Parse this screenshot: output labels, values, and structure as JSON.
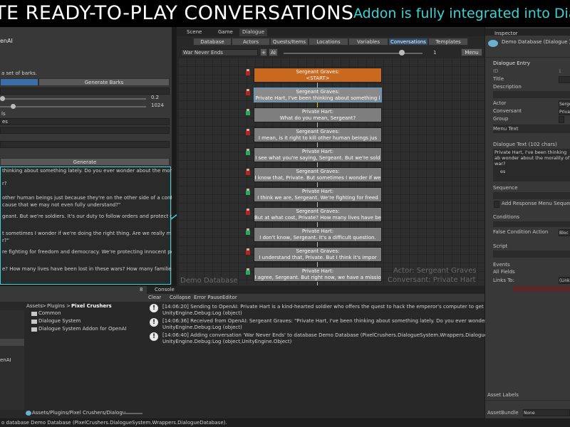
{
  "banner": {
    "title": "TE READY-TO-PLAY CONVERSATIONS",
    "subtitle": "Addon is fully integrated into Dia"
  },
  "left_panel": {
    "title": "enAI",
    "description": "a set of barks.",
    "generate_barks_label": "Generate Barks",
    "slider1_value": "0.2",
    "slider2_value": "1024",
    "label_ls": "ls",
    "label_es": "es",
    "generate_label": "Generate",
    "output_lines": [
      "thinking about something lately. Do you ever wonder about the morality of",
      "r?",
      "other human beings just because they're on the other side of a conflict? Is it",
      "cause that we may not even fully understand?\"",
      "geant. But we're soldiers. It's our duty to follow orders and protect our",
      "t sometimes I wonder if we're doing the right thing. Are we really making the",
      "r?\"",
      "re fighting for freedom and democracy. We're protecting innocent people",
      "e? How many lives have been lost in these wars? How many families have"
    ]
  },
  "editor_tabs": {
    "scene": "Scene",
    "game": "Game",
    "dialogue": "Dialogue"
  },
  "dialogue_tabs": [
    "Database",
    "Actors",
    "Quests/Items",
    "Locations",
    "Variables",
    "Conversations",
    "Templates"
  ],
  "active_dialogue_tab": "Conversations",
  "conversation_toolbar": {
    "conversation": "War Never Ends",
    "plus": "+",
    "ai": "AI",
    "zoom": "1",
    "menu": "Menu"
  },
  "nodes": [
    {
      "speaker": "Sergeant Graves:",
      "text": "<START>"
    },
    {
      "speaker": "Sergeant Graves:",
      "text": "Private Hart, I've been thinking about something l"
    },
    {
      "speaker": "Private Hart:",
      "text": "What do you mean, Sergeant?"
    },
    {
      "speaker": "Sergeant Graves:",
      "text": "I mean, is it right to kill other human beings jus"
    },
    {
      "speaker": "Private Hart:",
      "text": "I see what you're saying, Sergeant. But we're sold"
    },
    {
      "speaker": "Sergeant Graves:",
      "text": "I know that, Private. But sometimes I wonder if we"
    },
    {
      "speaker": "Private Hart:",
      "text": "I think we are, Sergeant. We're fighting for freed"
    },
    {
      "speaker": "Sergeant Graves:",
      "text": "But at what cost, Private? How many lives have bee"
    },
    {
      "speaker": "Private Hart:",
      "text": "I don't know, Sergeant. It's a difficult question."
    },
    {
      "speaker": "Sergeant Graves:",
      "text": "I understand that, Private. But I think it's impor"
    },
    {
      "speaker": "Private Hart:",
      "text": "I agree, Sergeant. But right now, we have a missio"
    }
  ],
  "canvas_watermark": {
    "database": "Demo Database",
    "actor": "Actor: Sergeant Graves",
    "conversant": "Conversant: Private Hart"
  },
  "project": {
    "breadcrumb_assets": "Assets",
    "breadcrumb_plugins": "Plugins",
    "breadcrumb_pixel": "Pixel Crushers",
    "folders": [
      "Common",
      "Dialogue System",
      "Dialogue System Addon for OpenAI"
    ],
    "left_item": "enAI",
    "path": "Assets/Plugins/Pixel Crushers/Dialogu",
    "badge_count": "8"
  },
  "console": {
    "title": "Console",
    "clear": "Clear",
    "collapse": "Collapse",
    "error_pause": "Error Pause",
    "editor": "Editor",
    "entries": [
      {
        "line1": "[14:06:20] Sending to OpenAI: Private Hart is a kind-hearted soldier who offers the quest to hack the emperor's computer to get the launch codes. S",
        "line2": "UnityEngine.Debug:Log (object)"
      },
      {
        "line1": "[14:06:36] Received from OpenAI: Sergeant Graves: \"Private Hart, I've been thinking about something lately. Do you ever wonder about the moralit",
        "line2": "UnityEngine.Debug:Log (object)"
      },
      {
        "line1": "[14:06:40] Adding conversation 'War Never Ends' to database Demo Database (PixelCrushers.DialogueSystem.Wrappers.DialogueDatabase).",
        "line2": "UnityEngine.Debug:Log (object,UnityEngine.Object)"
      }
    ]
  },
  "inspector": {
    "title": "Inspector",
    "object": "Demo Database (Dialogue )",
    "section": "Dialogue Entry",
    "id_label": "ID",
    "id_value": "1",
    "title_label": "Title",
    "description_label": "Description",
    "actor_label": "Actor",
    "actor_value": "Serge",
    "conversant_label": "Conversant",
    "conversant_value": "Priva",
    "group_label": "Group",
    "menu_text_label": "Menu Text",
    "dialogue_text_label": "Dialogue Text (102 chars)",
    "dialogue_text": "Private Hart, I've been thinking ab wonder about the morality of war?",
    "es_label": "es",
    "sequence_label": "Sequence",
    "add_response_label": "Add Response Menu Sequence",
    "conditions_label": "Conditions",
    "false_condition_label": "False Condition Action",
    "false_condition_value": "Bloc",
    "script_label": "Script",
    "events_label": "Events",
    "all_fields_label": "All Fields",
    "links_to_label": "Links To:",
    "links_to_value": "(Link",
    "asset_labels": "Asset Labels",
    "asset_bundle_label": "AssetBundle",
    "asset_bundle_value": "None"
  },
  "status_bar": "o database Demo Database (PixelCrushers.DialogueSystem.Wrappers.DialogueDatabase)."
}
